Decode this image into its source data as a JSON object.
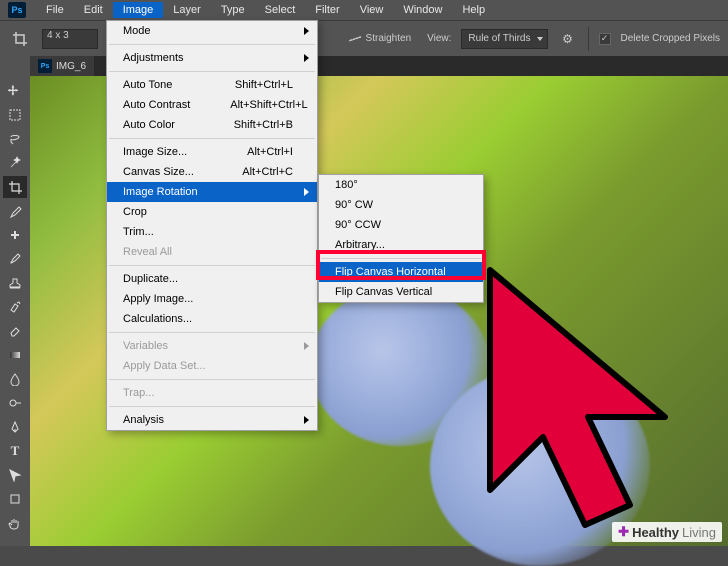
{
  "menubar": {
    "items": [
      "File",
      "Edit",
      "Image",
      "Layer",
      "Type",
      "Select",
      "Filter",
      "View",
      "Window",
      "Help"
    ]
  },
  "options": {
    "ratio": "4 x 3",
    "straighten": "Straighten",
    "view_label": "View:",
    "view_value": "Rule of Thirds",
    "delete_cropped": "Delete Cropped Pixels"
  },
  "doc_tab": "IMG_6",
  "image_menu": [
    {
      "label": "Mode",
      "sub": true
    },
    {
      "sep": true
    },
    {
      "label": "Adjustments",
      "sub": true
    },
    {
      "sep": true
    },
    {
      "label": "Auto Tone",
      "shortcut": "Shift+Ctrl+L"
    },
    {
      "label": "Auto Contrast",
      "shortcut": "Alt+Shift+Ctrl+L"
    },
    {
      "label": "Auto Color",
      "shortcut": "Shift+Ctrl+B"
    },
    {
      "sep": true
    },
    {
      "label": "Image Size...",
      "shortcut": "Alt+Ctrl+I"
    },
    {
      "label": "Canvas Size...",
      "shortcut": "Alt+Ctrl+C"
    },
    {
      "label": "Image Rotation",
      "sub": true,
      "hover": true
    },
    {
      "label": "Crop"
    },
    {
      "label": "Trim..."
    },
    {
      "label": "Reveal All",
      "disabled": true
    },
    {
      "sep": true
    },
    {
      "label": "Duplicate..."
    },
    {
      "label": "Apply Image..."
    },
    {
      "label": "Calculations..."
    },
    {
      "sep": true
    },
    {
      "label": "Variables",
      "sub": true,
      "disabled": true
    },
    {
      "label": "Apply Data Set...",
      "disabled": true
    },
    {
      "sep": true
    },
    {
      "label": "Trap...",
      "disabled": true
    },
    {
      "sep": true
    },
    {
      "label": "Analysis",
      "sub": true
    }
  ],
  "rotation_menu": [
    {
      "label": "180°"
    },
    {
      "label": "90° CW"
    },
    {
      "label": "90° CCW"
    },
    {
      "label": "Arbitrary..."
    },
    {
      "sep": true
    },
    {
      "label": "Flip Canvas Horizontal",
      "hover": true
    },
    {
      "label": "Flip Canvas Vertical"
    }
  ],
  "watermark": {
    "brand1": "Healthy",
    "brand2": "Living"
  }
}
